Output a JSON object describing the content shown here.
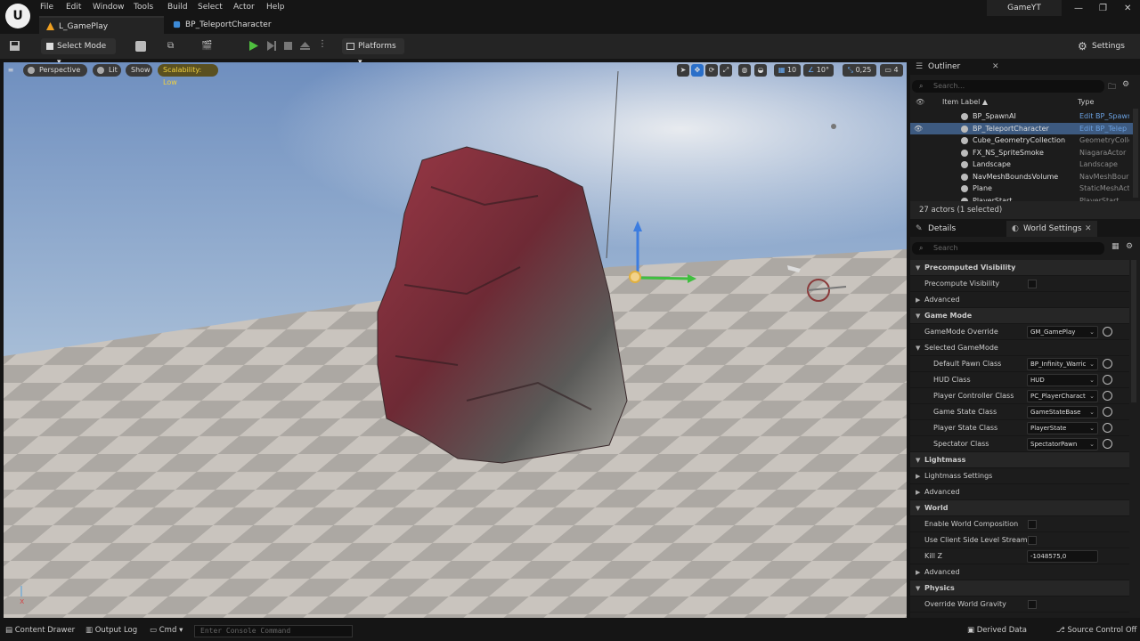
{
  "menu": [
    "File",
    "Edit",
    "Window",
    "Tools",
    "Build",
    "Select",
    "Actor",
    "Help"
  ],
  "tabs": [
    {
      "label": "L_GamePlay"
    },
    {
      "label": "BP_TeleportCharacter"
    }
  ],
  "project_name": "GameYT",
  "toolbar": {
    "select_mode": "Select Mode",
    "platforms": "Platforms",
    "settings": "Settings"
  },
  "viewport": {
    "perspective": "Perspective",
    "lit": "Lit",
    "show": "Show",
    "scalability": "Scalability: Low",
    "grid_snap": "10",
    "rot_snap": "10°",
    "scale_snap": "0,25",
    "cam_speed": "4"
  },
  "outliner": {
    "title": "Outliner",
    "search_placeholder": "Search...",
    "col_label": "Item Label ▲",
    "col_type": "Type",
    "rows": [
      {
        "label": "BP_SpawnAI",
        "type": "Edit BP_Spawn",
        "selected": false
      },
      {
        "label": "BP_TeleportCharacter",
        "type": "Edit BP_Telep",
        "selected": true
      },
      {
        "label": "Cube_GeometryCollection",
        "type": "GeometryColle",
        "selected": false
      },
      {
        "label": "FX_NS_SpriteSmoke",
        "type": "NiagaraActor",
        "selected": false
      },
      {
        "label": "Landscape",
        "type": "Landscape",
        "selected": false
      },
      {
        "label": "NavMeshBoundsVolume",
        "type": "NavMeshBour",
        "selected": false
      },
      {
        "label": "Plane",
        "type": "StaticMeshAct",
        "selected": false
      },
      {
        "label": "PlayerStart",
        "type": "PlayerStart",
        "selected": false
      }
    ],
    "footer": "27 actors (1 selected)"
  },
  "details": {
    "tab_details": "Details",
    "tab_world": "World Settings",
    "search_placeholder": "Search",
    "rows": [
      {
        "kind": "section",
        "label": "Precomputed Visibility"
      },
      {
        "kind": "check",
        "label": "Precompute Visibility"
      },
      {
        "kind": "sub",
        "label": "Advanced"
      },
      {
        "kind": "section",
        "label": "Game Mode"
      },
      {
        "kind": "dropdown",
        "label": "GameMode Override",
        "value": "GM_GamePlay",
        "indent": 0
      },
      {
        "kind": "subopen",
        "label": "Selected GameMode"
      },
      {
        "kind": "dropdown",
        "label": "Default Pawn Class",
        "value": "BP_Infinity_Warric",
        "indent": 1
      },
      {
        "kind": "dropdown",
        "label": "HUD Class",
        "value": "HUD",
        "indent": 1
      },
      {
        "kind": "dropdown",
        "label": "Player Controller Class",
        "value": "PC_PlayerCharact",
        "indent": 1
      },
      {
        "kind": "dropdown",
        "label": "Game State Class",
        "value": "GameStateBase",
        "indent": 1
      },
      {
        "kind": "dropdown",
        "label": "Player State Class",
        "value": "PlayerState",
        "indent": 1
      },
      {
        "kind": "dropdown",
        "label": "Spectator Class",
        "value": "SpectatorPawn",
        "indent": 1
      },
      {
        "kind": "section",
        "label": "Lightmass"
      },
      {
        "kind": "sub",
        "label": "Lightmass Settings"
      },
      {
        "kind": "sub",
        "label": "Advanced"
      },
      {
        "kind": "section",
        "label": "World"
      },
      {
        "kind": "check",
        "label": "Enable World Composition"
      },
      {
        "kind": "check",
        "label": "Use Client Side Level Streami..."
      },
      {
        "kind": "field",
        "label": "Kill Z",
        "value": "-1048575,0"
      },
      {
        "kind": "sub",
        "label": "Advanced"
      },
      {
        "kind": "section",
        "label": "Physics"
      },
      {
        "kind": "check",
        "label": "Override World Gravity"
      }
    ]
  },
  "status": {
    "content_drawer": "Content Drawer",
    "output_log": "Output Log",
    "cmd": "Cmd",
    "console_placeholder": "Enter Console Command",
    "derived_data": "Derived Data",
    "source_control": "Source Control Off"
  }
}
